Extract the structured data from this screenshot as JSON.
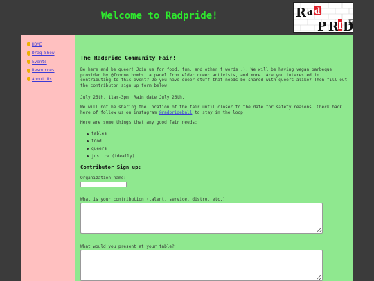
{
  "header": {
    "title": "Welcome to Radpride!",
    "logo_text": "Radpride"
  },
  "sidebar": {
    "items": [
      {
        "label": "HOME"
      },
      {
        "label": "Drag Show"
      },
      {
        "label": "Events"
      },
      {
        "label": "Resources"
      },
      {
        "label": "About Us"
      }
    ]
  },
  "main": {
    "heading": "The Radpride Community Fair!",
    "intro": "Be here and be queer! Join us for food, fun, and other f words ;). We will be having vegan barbeque provided by @foodnotbombs, a panel from elder queer activists, and more. Are you interested in contributing to this event? Do you have queer stuff that needs be shared with queers alike? Then fill out the contributor sign up form below!",
    "date_line": "July 25th, 11am-3pm. Rain date July 26th.",
    "location_pre": "We will not be sharing the location of the fair until closer to the date for safety reasons. Check back here of follow us on instagram ",
    "instagram_handle": "@radprideball",
    "location_post": " to stay in the loop!",
    "needs_intro": "Here are some things that any good fair needs:",
    "needs": [
      "tables",
      "food",
      "queers",
      "justice (ideally)"
    ],
    "form": {
      "heading": "Contributor Sign up:",
      "org_label": "Organization name:",
      "contribution_label": "What is your contribution (talent, service, distro, etc.)",
      "present_label": "What would you present at your table?"
    }
  },
  "colors": {
    "background": "#3b3b3b",
    "title": "#2ee82e",
    "sidebar": "#ffc0c0",
    "main": "#8fe88f",
    "link": "#3b3bd6"
  }
}
